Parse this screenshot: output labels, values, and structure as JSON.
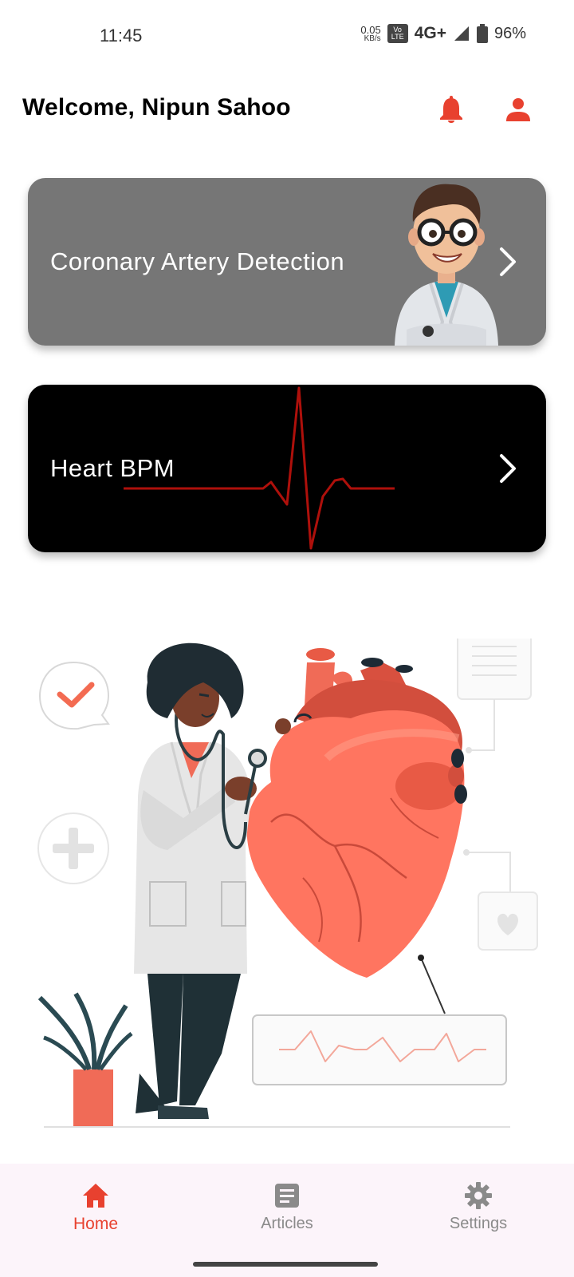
{
  "status_bar": {
    "time": "11:45",
    "net_speed": "0.05",
    "net_unit": "KB/s",
    "volte_top": "Vo",
    "volte_bottom": "LTE",
    "network": "4G+",
    "battery": "96%"
  },
  "header": {
    "welcome": "Welcome, Nipun Sahoo",
    "icons": [
      "bell-icon",
      "person-icon"
    ]
  },
  "cards": [
    {
      "title": "Coronary Artery Detection",
      "background": "#767676"
    },
    {
      "title": "Heart BPM",
      "background": "#000000"
    }
  ],
  "colors": {
    "accent": "#e8412f",
    "heart": "#ff6f5b",
    "nav_background": "#fcf4fa"
  },
  "bottom_nav": {
    "items": [
      {
        "label": "Home",
        "icon": "home-icon",
        "active": true
      },
      {
        "label": "Articles",
        "icon": "article-icon",
        "active": false
      },
      {
        "label": "Settings",
        "icon": "gear-icon",
        "active": false
      }
    ]
  }
}
